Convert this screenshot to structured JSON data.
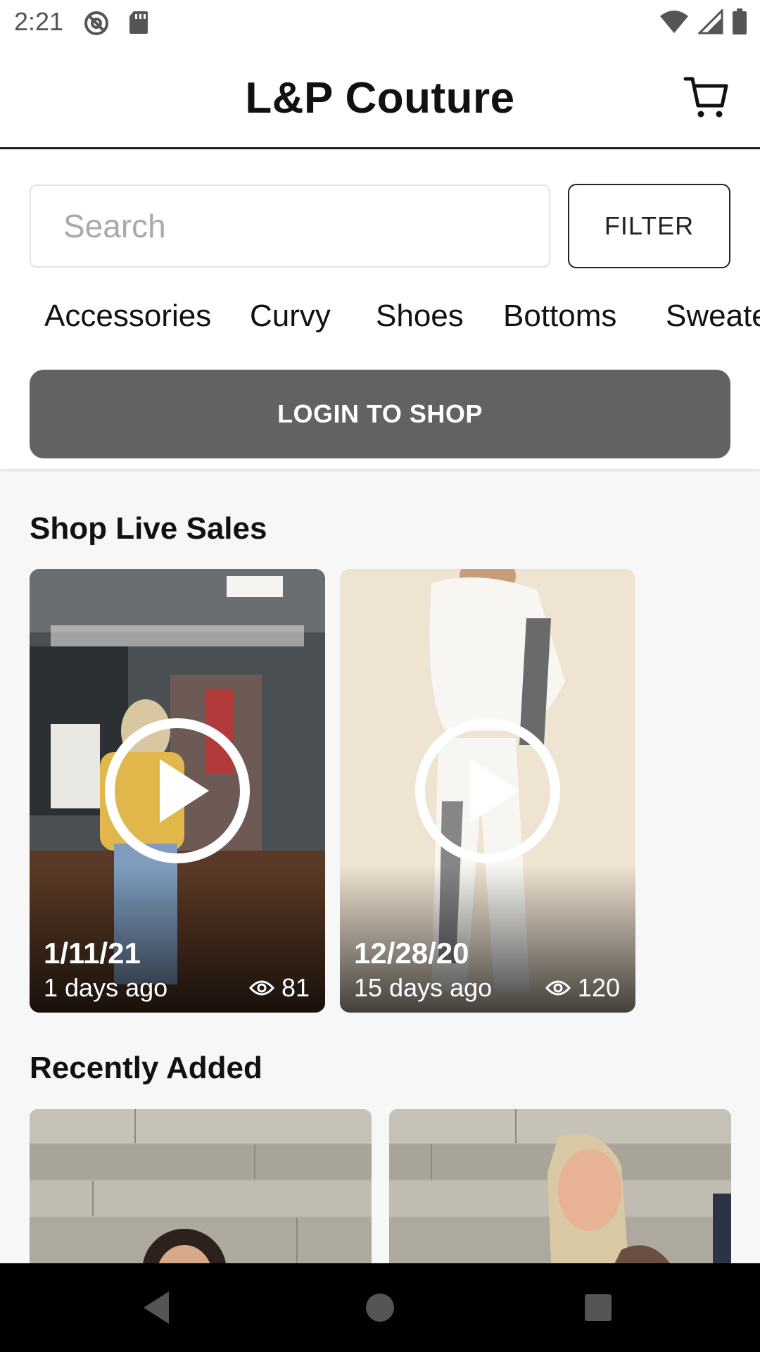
{
  "status_bar": {
    "time": "2:21",
    "left_icons": [
      "do-not-disturb-icon",
      "sd-card-icon"
    ],
    "right_icons": [
      "wifi-icon",
      "cellular-signal-icon",
      "battery-icon"
    ]
  },
  "header": {
    "title": "L&P Couture",
    "cart_icon": "cart-icon"
  },
  "search": {
    "placeholder": "Search",
    "value": "",
    "filter_label": "FILTER"
  },
  "categories": [
    "Accessories",
    "Curvy",
    "Shoes",
    "Bottoms",
    "Sweate"
  ],
  "login_button": {
    "label": "LOGIN TO SHOP",
    "color": "#626262"
  },
  "live_sales": {
    "title": "Shop Live Sales",
    "cards": [
      {
        "date": "1/11/21",
        "ago": "1 days ago",
        "views": "81"
      },
      {
        "date": "12/28/20",
        "ago": "15 days ago",
        "views": "120"
      }
    ]
  },
  "recently_added": {
    "title": "Recently Added"
  },
  "nav_bar": {
    "buttons": [
      "back-icon",
      "home-icon",
      "recents-icon"
    ]
  }
}
